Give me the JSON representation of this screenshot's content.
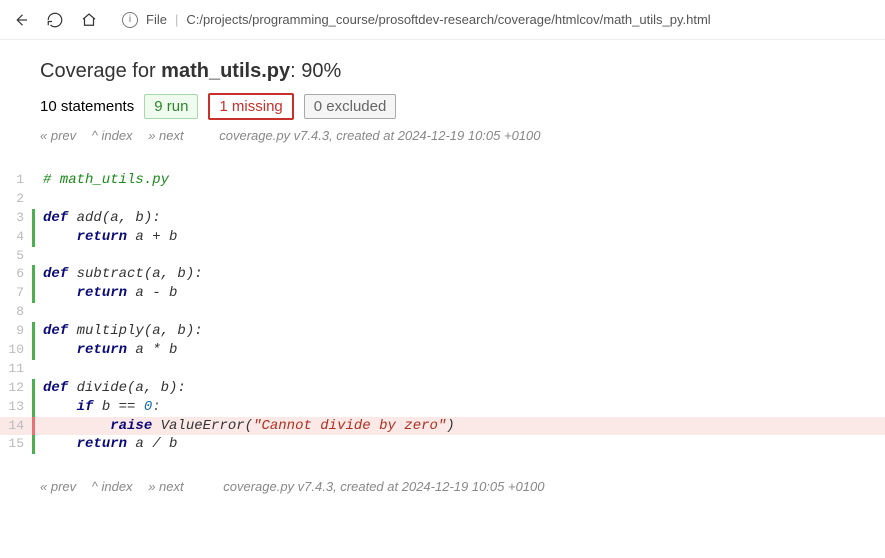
{
  "browser": {
    "url_scheme": "File",
    "url_path": "C:/projects/programming_course/prosoftdev-research/coverage/htmlcov/math_utils_py.html"
  },
  "header": {
    "prefix": "Coverage for ",
    "filename": "math_utils.py",
    "suffix": ": 90%",
    "statements": "10 statements",
    "run": "9 run",
    "missing": "1 missing",
    "excluded": "0 excluded"
  },
  "nav": {
    "prev": "« prev",
    "index": "^ index",
    "next": "» next",
    "generated": "coverage.py v7.4.3, created at 2024-12-19 10:05 +0100"
  },
  "code": {
    "l1_comment": "# math_utils.py",
    "l3_def": "def",
    "l3_name": " add(a, b):",
    "l4_return": "return",
    "l4_expr": " a + b",
    "l6_def": "def",
    "l6_name": " subtract(a, b):",
    "l7_return": "return",
    "l7_expr": " a - b",
    "l9_def": "def",
    "l9_name": " multiply(a, b):",
    "l10_return": "return",
    "l10_expr": " a * b",
    "l12_def": "def",
    "l12_name": " divide(a, b):",
    "l13_if": "if",
    "l13_cond": " b == ",
    "l13_num": "0",
    "l13_colon": ":",
    "l14_raise": "raise",
    "l14_exc": " ValueError(",
    "l14_str": "\"Cannot divide by zero\"",
    "l14_close": ")",
    "l15_return": "return",
    "l15_expr": " a / b"
  }
}
